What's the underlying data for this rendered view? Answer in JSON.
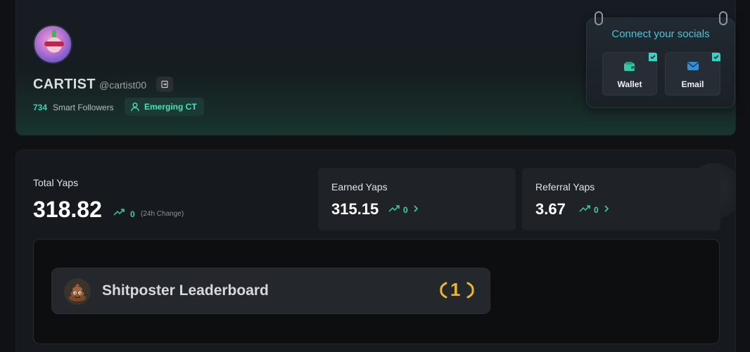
{
  "profile": {
    "name": "CARTIST",
    "handle": "@cartist00",
    "followers_count": "734",
    "followers_label": "Smart Followers",
    "badge": "Emerging CT"
  },
  "socials": {
    "title": "Connect your socials",
    "wallet_label": "Wallet",
    "email_label": "Email"
  },
  "yaps": {
    "total_label": "Total Yaps",
    "total_value": "318.82",
    "total_change": "0",
    "total_change_note": "(24h Change)",
    "earned_label": "Earned Yaps",
    "earned_value": "315.15",
    "earned_change": "0",
    "referral_label": "Referral Yaps",
    "referral_value": "3.67",
    "referral_change": "0"
  },
  "leaderboard": {
    "title": "Shitposter Leaderboard",
    "rank": "1"
  },
  "colors": {
    "accent_teal": "#3ed0b0",
    "accent_cyan": "#4ec3dc",
    "gold": "#e7b732"
  },
  "icons": {
    "exit": "exit-icon",
    "user": "user-icon",
    "wallet": "wallet-icon",
    "email": "mail-icon",
    "check": "check-icon",
    "trend": "trend-up-icon",
    "chevron": "chevron-right-icon",
    "poop": "poop-emoji-icon",
    "laurel": "laurel-icon"
  }
}
